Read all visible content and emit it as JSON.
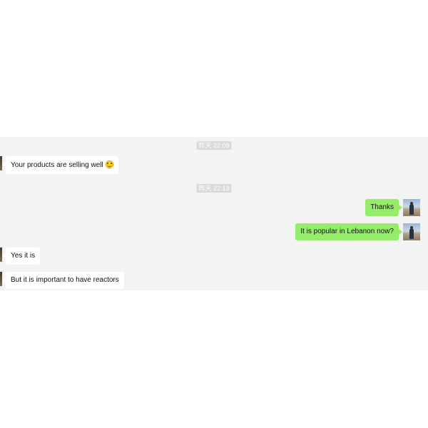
{
  "conversation": {
    "timestamps": [
      "昨天 22:08",
      "昨天 22:13"
    ],
    "messages": [
      {
        "side": "left",
        "text": "Your products are selling well",
        "emoji": "smiling-face"
      },
      {
        "side": "right",
        "text": "Thanks"
      },
      {
        "side": "right",
        "text": "It is popular in Lebanon now?"
      },
      {
        "side": "left",
        "text": "Yes it is"
      },
      {
        "side": "left",
        "text": "But it is important to have reactors"
      }
    ]
  },
  "colors": {
    "chat_background": "#f3f3f3",
    "incoming_bubble": "#ffffff",
    "outgoing_bubble": "#95ec69",
    "timestamp_background": "#dadada"
  }
}
